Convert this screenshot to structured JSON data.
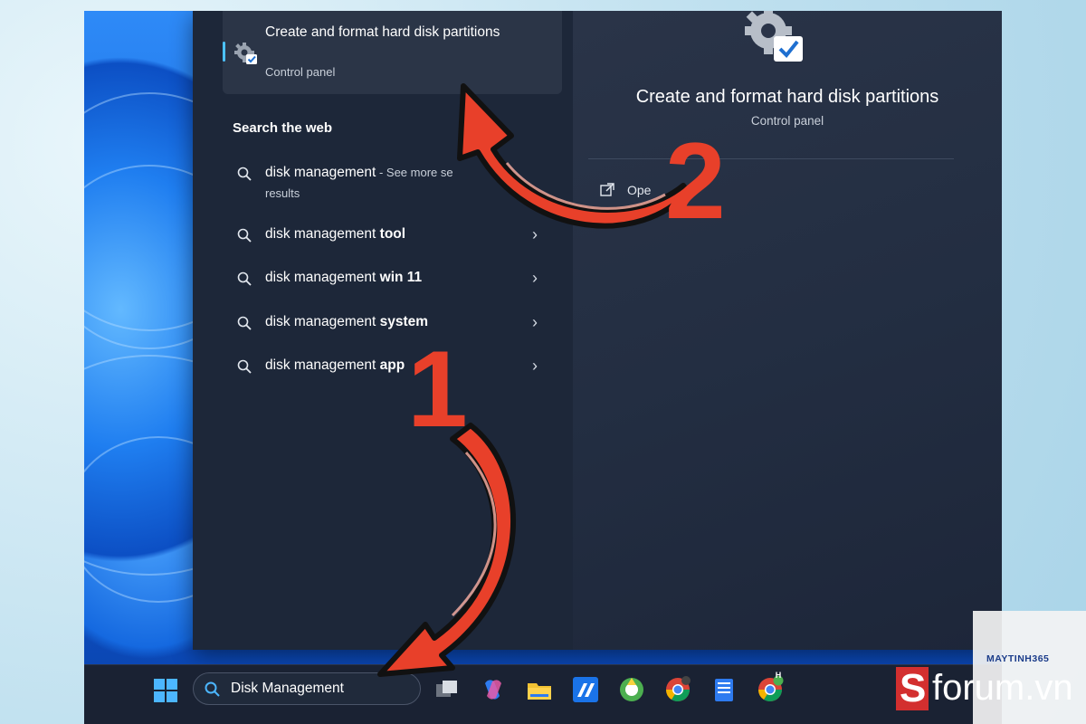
{
  "best_match": {
    "title": "Create and format hard disk partitions",
    "subtitle": "Control panel"
  },
  "web_section_title": "Search the web",
  "web_results": [
    {
      "base": "disk management",
      "bold": "",
      "extra": " - See more se",
      "sub": "results",
      "has_chevron": false
    },
    {
      "base": "disk management ",
      "bold": "tool",
      "extra": "",
      "sub": "",
      "has_chevron": true
    },
    {
      "base": "disk management ",
      "bold": "win 11",
      "extra": "",
      "sub": "",
      "has_chevron": true
    },
    {
      "base": "disk management ",
      "bold": "system",
      "extra": "",
      "sub": "",
      "has_chevron": true
    },
    {
      "base": "disk management ",
      "bold": "app",
      "extra": "",
      "sub": "",
      "has_chevron": true
    }
  ],
  "preview": {
    "title": "Create and format hard disk partitions",
    "subtitle": "Control panel",
    "open_label": "Ope"
  },
  "taskbar": {
    "search_value": "Disk Management",
    "chrome_badge": "H"
  },
  "annotations": {
    "step1": "1",
    "step2": "2",
    "arrow_color": "#e8402a"
  },
  "watermarks": {
    "maytinh": "MAYTINH365",
    "forum_s": "S",
    "forum": "forum.vn"
  },
  "colors": {
    "accent": "#4cc2ff",
    "panel": "#1f2a3d",
    "taskbar": "#1a2233"
  },
  "icons": [
    "gear-check-icon",
    "search-icon",
    "chevron-right-icon",
    "open-external-icon",
    "windows-start-icon",
    "task-view-icon",
    "copilot-icon",
    "file-explorer-icon",
    "app-icon",
    "chrome-icon",
    "notepad-icon"
  ]
}
